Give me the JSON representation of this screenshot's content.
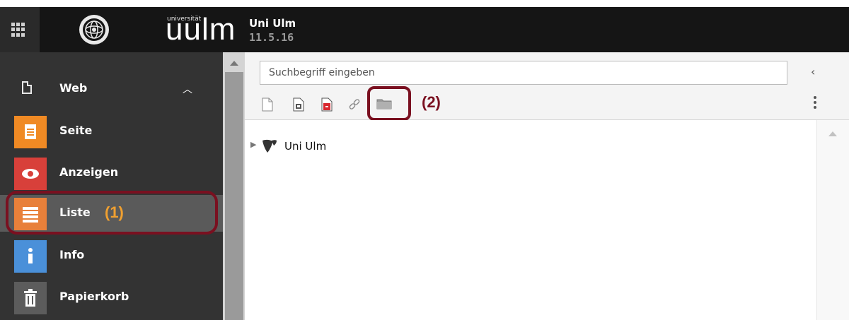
{
  "topbar": {
    "logo_small": "universität",
    "logo_big": "uulm",
    "site_name": "Uni Ulm",
    "site_version": "11.5.16"
  },
  "sidebar": {
    "group_label": "Web",
    "items": [
      {
        "label": "Seite",
        "icon": "page-icon",
        "color": "#f08a24"
      },
      {
        "label": "Anzeigen",
        "icon": "eye-icon",
        "color": "#d8403a"
      },
      {
        "label": "Liste",
        "icon": "list-icon",
        "color": "#e8803a",
        "active": true
      },
      {
        "label": "Info",
        "icon": "info-icon",
        "color": "#4a90d9"
      },
      {
        "label": "Papierkorb",
        "icon": "trash-icon",
        "color": "#5c5c5c"
      }
    ],
    "annotation": "(1)"
  },
  "pagetree": {
    "search_placeholder": "Suchbegriff eingeben",
    "toolbar_icons": [
      "new-page-icon",
      "page-template-icon",
      "page-red-icon",
      "link-icon",
      "folder-icon"
    ],
    "annotation": "(2)",
    "root_node": "Uni Ulm"
  },
  "colors": {
    "topbar": "#151515",
    "sidebar": "#333333",
    "highlight": "#7a1020",
    "annotation1": "#f0a030"
  }
}
